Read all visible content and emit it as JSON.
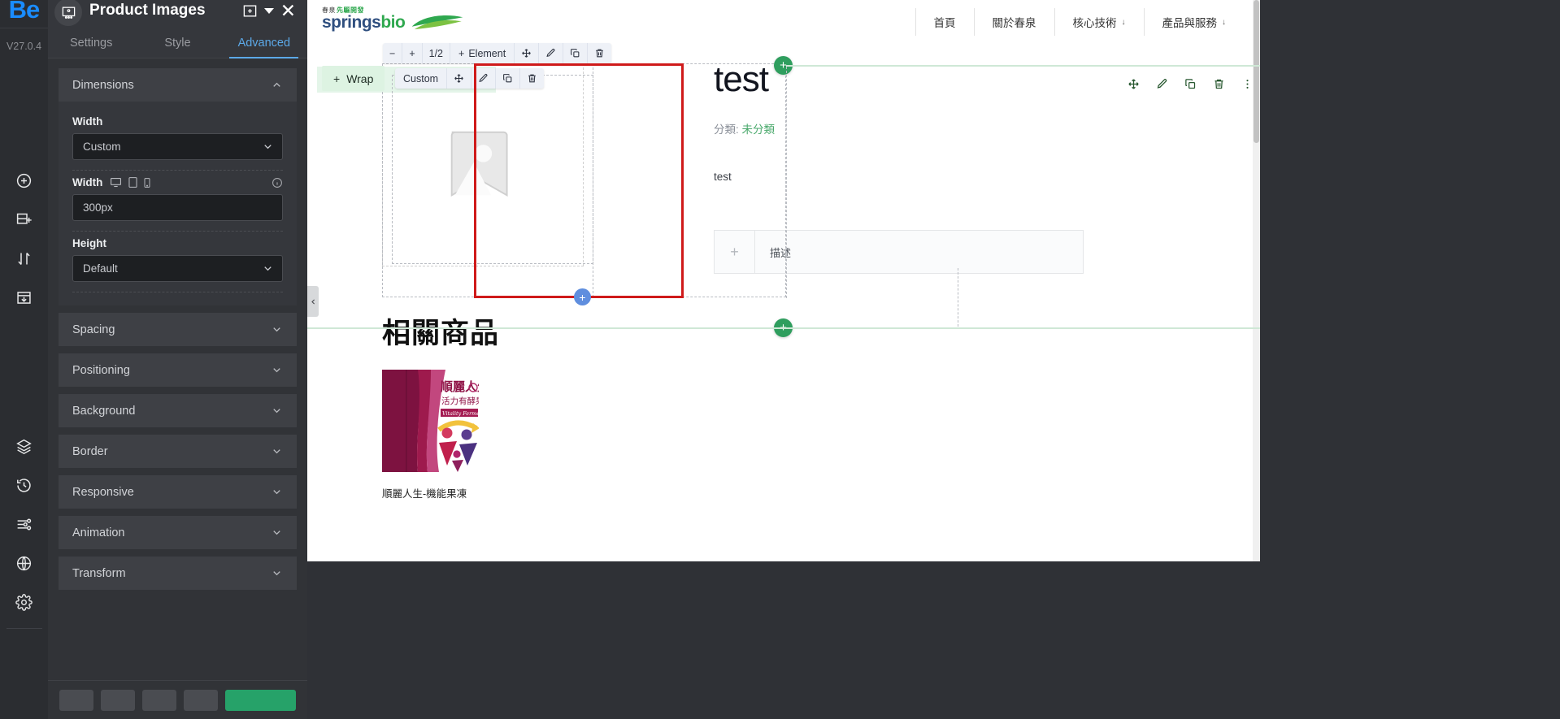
{
  "rail": {
    "logo": "Be",
    "version": "V27.0.4",
    "items": [
      {
        "name": "add-element-icon",
        "label": "Add Element"
      },
      {
        "name": "add-section-icon",
        "label": "Add Section"
      },
      {
        "name": "reorder-icon",
        "label": "Reorder"
      },
      {
        "name": "save-to-library-icon",
        "label": "Save To Library"
      },
      {
        "name": "layers-icon",
        "label": "Layers"
      },
      {
        "name": "history-icon",
        "label": "History"
      },
      {
        "name": "settings-sliders-icon",
        "label": "Settings"
      },
      {
        "name": "globe-icon",
        "label": "Global"
      },
      {
        "name": "gear-icon",
        "label": "Preferences"
      }
    ]
  },
  "panel": {
    "title": "Product Images",
    "tabs": [
      {
        "label": "Settings",
        "active": false
      },
      {
        "label": "Style",
        "active": false
      },
      {
        "label": "Advanced",
        "active": true
      }
    ],
    "sections": [
      {
        "label": "Dimensions",
        "expanded": true
      },
      {
        "label": "Spacing",
        "expanded": false
      },
      {
        "label": "Positioning",
        "expanded": false
      },
      {
        "label": "Background",
        "expanded": false
      },
      {
        "label": "Border",
        "expanded": false
      },
      {
        "label": "Responsive",
        "expanded": false
      },
      {
        "label": "Animation",
        "expanded": false
      },
      {
        "label": "Transform",
        "expanded": false
      }
    ],
    "dimensions": {
      "width_type_label": "Width",
      "width_type_value": "Custom",
      "width_label": "Width",
      "width_value": "300px",
      "height_label": "Height",
      "height_value": "Default"
    },
    "footer": {
      "buttons": [
        "",
        "",
        "",
        ""
      ],
      "primary_label": ""
    }
  },
  "canvas": {
    "element_toolbar": {
      "zoom_out": "−",
      "zoom_in": "+",
      "fraction": "1/2",
      "add_label": "Element",
      "add_icon": "+"
    },
    "widget_toolbar": {
      "label": "Custom"
    },
    "wrap_button": {
      "label": "Wrap",
      "icon": "+"
    }
  },
  "site": {
    "logo": {
      "cn_prefix": "春泉",
      "cn_highlight": "先驅開發",
      "en_first": "springs",
      "en_second": "bio"
    },
    "nav": [
      {
        "label": "首頁",
        "has_caret": false
      },
      {
        "label": "關於春泉",
        "has_caret": false
      },
      {
        "label": "核心技術",
        "has_caret": true
      },
      {
        "label": "產品與服務",
        "has_caret": true
      }
    ],
    "product": {
      "title": "test",
      "category_label": "分類:",
      "category_value": "未分類",
      "description": "test",
      "accordion_label": "描述",
      "accordion_icon": "+"
    },
    "related": {
      "heading": "相關商品",
      "items": [
        {
          "name": "順麗人生-機能果凍",
          "thumb_title": "順麗人生",
          "thumb_sub": "活力有酵果凍",
          "thumb_en": "Vitality Fermented Jelly"
        }
      ]
    }
  },
  "colors": {
    "accent_blue": "#5ca9e8",
    "selection_red": "#cf1a1a",
    "green_add": "#2f9e5e",
    "blue_add": "#5f8ede",
    "brand_green": "#2fa84f",
    "brand_navy": "#2f4f7f"
  }
}
